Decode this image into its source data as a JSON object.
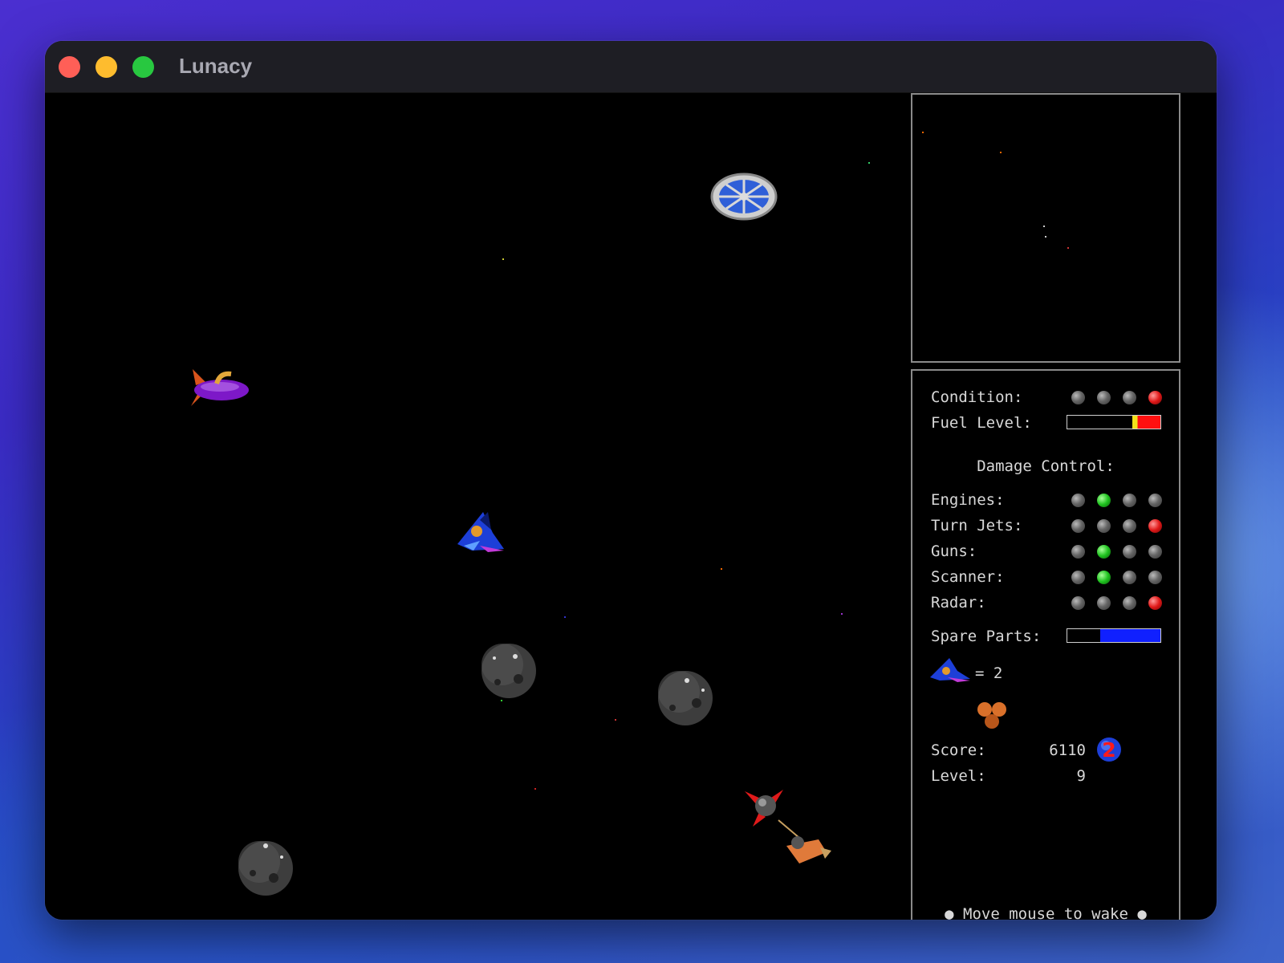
{
  "window": {
    "title": "Lunacy"
  },
  "status": {
    "condition": {
      "label": "Condition:",
      "lights": [
        "off",
        "off",
        "off",
        "red"
      ]
    },
    "fuel": {
      "label": "Fuel Level:",
      "level": 0.3
    },
    "damage_control": {
      "label": "Damage Control:",
      "systems": [
        {
          "label": "Engines:",
          "lights": [
            "off",
            "green",
            "off",
            "off"
          ]
        },
        {
          "label": "Turn Jets:",
          "lights": [
            "off",
            "off",
            "off",
            "red"
          ]
        },
        {
          "label": "Guns:",
          "lights": [
            "off",
            "green",
            "off",
            "off"
          ]
        },
        {
          "label": "Scanner:",
          "lights": [
            "off",
            "green",
            "off",
            "off"
          ]
        },
        {
          "label": "Radar:",
          "lights": [
            "off",
            "off",
            "off",
            "red"
          ]
        }
      ]
    },
    "spare_parts": {
      "label": "Spare Parts:",
      "level": 0.65
    },
    "ships_remaining": "= 2",
    "score": {
      "label": "Score:",
      "value": "6110",
      "multiplier": "2"
    },
    "level": {
      "label": "Level:",
      "value": "9"
    },
    "footer": "● Move mouse to wake ●"
  },
  "colors": {
    "lamp_green": "#1fc21f",
    "lamp_red": "#e01818",
    "fuel_yellow": "#f2e21a",
    "fuel_red": "#ff1010",
    "spare_blue": "#1020ff"
  }
}
